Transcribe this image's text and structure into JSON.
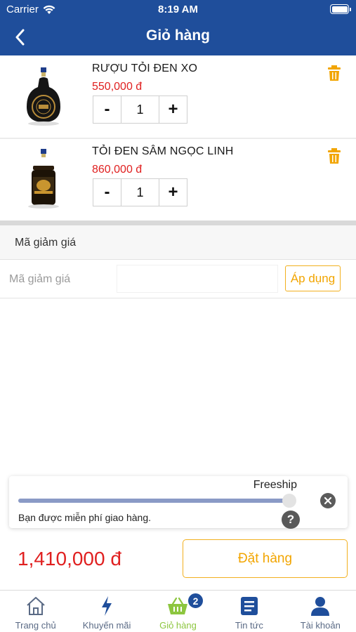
{
  "status_bar": {
    "carrier": "Carrier",
    "time": "8:19 AM"
  },
  "header": {
    "title": "Giỏ hàng"
  },
  "cart": {
    "items": [
      {
        "name": "RƯỢU TỎI ĐEN XO",
        "price": "550,000 đ",
        "quantity": "1"
      },
      {
        "name": "TỎI ĐEN SÂM NGỌC LINH",
        "price": "860,000 đ",
        "quantity": "1"
      }
    ],
    "minus_label": "-",
    "plus_label": "+"
  },
  "discount": {
    "section_title": "Mã giảm giá",
    "field_label": "Mã giảm giá",
    "input_value": "",
    "apply_label": "Áp dụng"
  },
  "freeship": {
    "label": "Freeship",
    "progress": 1.0,
    "message": "Bạn được miễn phí giao hàng.",
    "help_label": "?"
  },
  "checkout": {
    "total": "1,410,000 đ",
    "order_label": "Đặt hàng"
  },
  "tabbar": {
    "active": "cart",
    "cart_badge": "2",
    "tabs": [
      {
        "id": "home",
        "label": "Trang chủ",
        "icon": "home-icon"
      },
      {
        "id": "promo",
        "label": "Khuyến mãi",
        "icon": "lightning-icon"
      },
      {
        "id": "cart",
        "label": "Giỏ hàng",
        "icon": "basket-icon"
      },
      {
        "id": "news",
        "label": "Tin tức",
        "icon": "news-icon"
      },
      {
        "id": "account",
        "label": "Tài khoản",
        "icon": "user-icon"
      }
    ]
  },
  "colors": {
    "header": "#1f4e9b",
    "price": "#e02020",
    "accent": "#f2a500",
    "active_tab": "#8dc63f",
    "inactive_tab": "#5a6a85"
  }
}
